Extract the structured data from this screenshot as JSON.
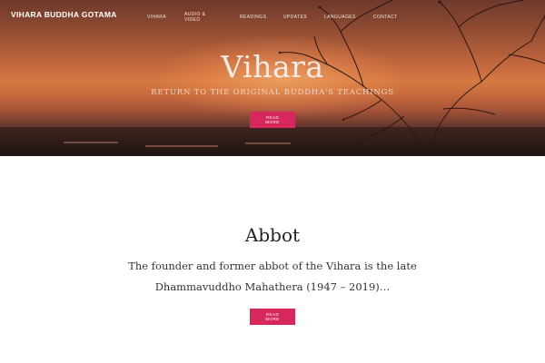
{
  "header": {
    "site_title": "VIHARA BUDDHA GOTAMA",
    "nav": [
      {
        "label": "VIHARA"
      },
      {
        "label": "AUDIO & VIDEO"
      },
      {
        "label": "READINGS"
      },
      {
        "label": "UPDATES"
      },
      {
        "label": "LANGUAGES"
      },
      {
        "label": "CONTACT"
      }
    ]
  },
  "hero": {
    "title": "Vihara",
    "subtitle": "RETURN TO THE ORIGINAL BUDDHA'S TEACHINGS",
    "button_label": "READ MORE"
  },
  "abbot": {
    "title": "Abbot",
    "text": "The founder and former abbot of the Vihara is the late Dhammavuddho Mahathera (1947 – 2019)…",
    "button_label": "READ MORE"
  },
  "colors": {
    "accent": "#d6285d",
    "hero_sky": "#cc6e3f"
  }
}
